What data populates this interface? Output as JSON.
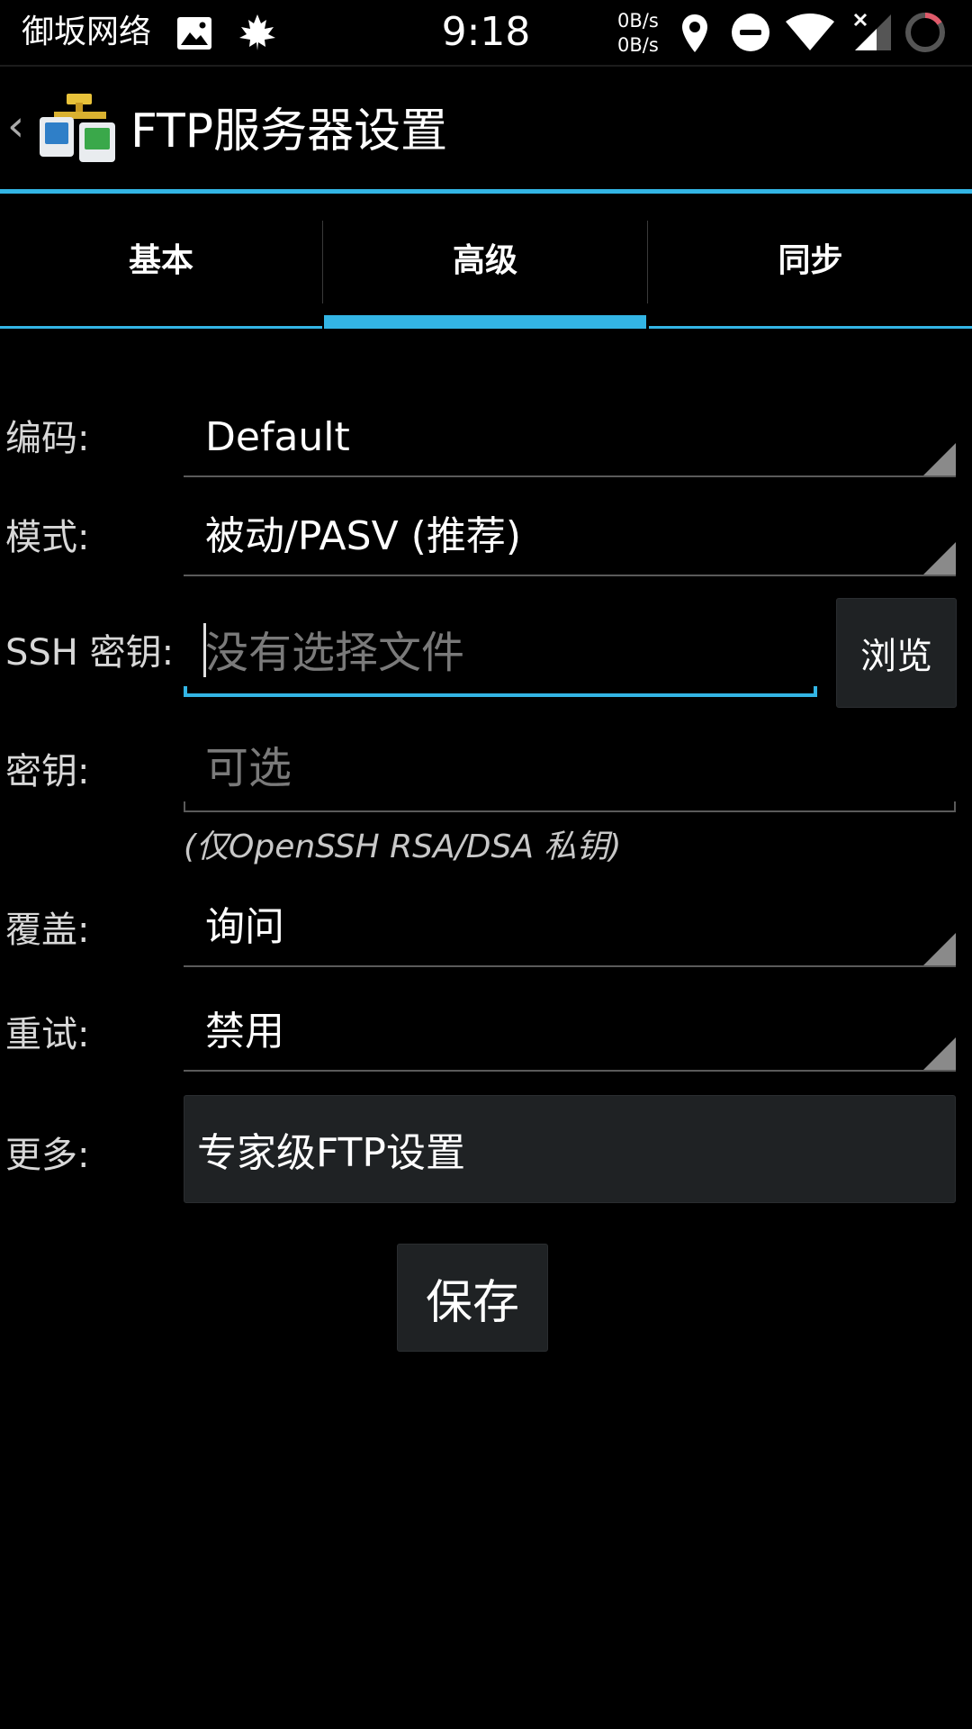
{
  "status_bar": {
    "carrier": "御坂网络",
    "time": "9:18",
    "upload_speed": "0B/s",
    "download_speed": "0B/s",
    "icons": [
      "image-icon",
      "maple-leaf-icon",
      "location-icon",
      "do-not-disturb-icon",
      "wifi-icon",
      "no-sim-signal-icon",
      "battery-ring-icon"
    ]
  },
  "action_bar": {
    "title": "FTP服务器设置",
    "app_icon": "ftp-server-icon"
  },
  "tabs": [
    {
      "label": "基本",
      "selected": false
    },
    {
      "label": "高级",
      "selected": true
    },
    {
      "label": "同步",
      "selected": false
    }
  ],
  "form": {
    "encoding": {
      "label": "编码:",
      "value": "Default"
    },
    "mode": {
      "label": "模式:",
      "value": "被动/PASV (推荐)"
    },
    "ssh_key": {
      "label": "SSH 密钥:",
      "value": "",
      "placeholder": "没有选择文件",
      "browse_label": "浏览"
    },
    "passphrase": {
      "label": "密钥:",
      "value": "",
      "placeholder": "可选",
      "hint": "(仅OpenSSH RSA/DSA 私钥)"
    },
    "overwrite": {
      "label": "覆盖:",
      "value": "询问"
    },
    "retry": {
      "label": "重试:",
      "value": "禁用"
    },
    "more": {
      "label": "更多:",
      "button_label": "专家级FTP设置"
    }
  },
  "save_label": "保存",
  "colors": {
    "accent": "#33b5e5",
    "background": "#000000",
    "button": "#1f2224"
  }
}
